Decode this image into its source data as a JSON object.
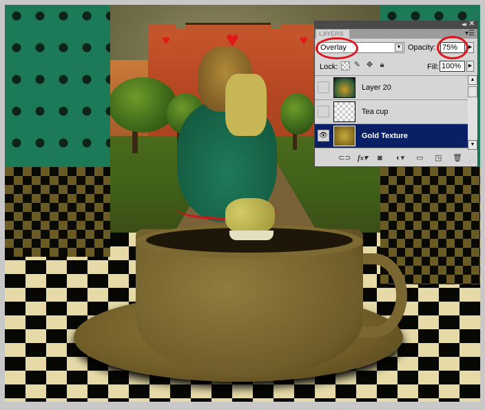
{
  "artwork": {
    "description": "Alice-in-Wonderland themed photo composite: girl sitting in giant cracked teacup on checkered floor",
    "colors": {
      "frame": "#c8c8c8",
      "teal": "#1c7a58",
      "wall_red": "#c6562a",
      "heart_red": "#e01818",
      "cup_gold": "#7c6a32"
    }
  },
  "layers_panel": {
    "tab_label": "LAYERS",
    "blend_mode": "Overlay",
    "opacity_label": "Opacity:",
    "opacity_value": "75%",
    "lock_label": "Lock:",
    "fill_label": "Fill:",
    "fill_value": "100%",
    "layers": [
      {
        "name": "Layer 20",
        "visible": false,
        "selected": false
      },
      {
        "name": "Tea cup",
        "visible": false,
        "selected": false
      },
      {
        "name": "Gold Texture",
        "visible": true,
        "selected": true
      }
    ],
    "footer_icons": [
      "link-layers-icon",
      "fx-icon",
      "layer-mask-icon",
      "adjustment-layer-icon",
      "new-group-icon",
      "new-layer-icon",
      "trash-icon"
    ],
    "selection_color": "#0a2064"
  },
  "annotations": {
    "circle_color": "#e0141c",
    "highlighted": [
      "blend-mode",
      "opacity"
    ]
  }
}
